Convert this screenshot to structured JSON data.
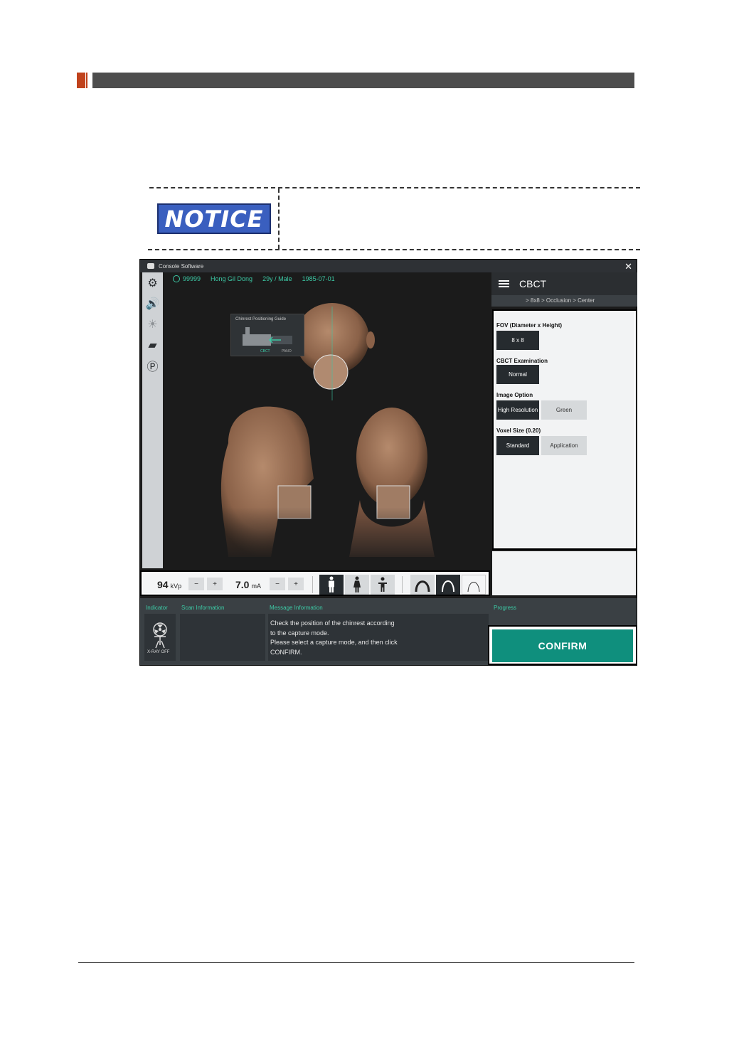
{
  "notice": {
    "label": "NOTICE"
  },
  "window": {
    "title": "Console Software",
    "close": "✕"
  },
  "patient": {
    "id": "99999",
    "name": "Hong Gil Dong",
    "age_sex": "29y / Male",
    "dob": "1985-07-01"
  },
  "toolbar": {
    "items": [
      {
        "icon": "gear-icon",
        "glyph": "⚙"
      },
      {
        "icon": "speaker-icon",
        "glyph": "🔊"
      },
      {
        "icon": "light-icon",
        "glyph": "☀"
      },
      {
        "icon": "layers-icon",
        "glyph": "▰"
      },
      {
        "icon": "p-settings-icon",
        "glyph": "Ⓟ"
      }
    ]
  },
  "guide": {
    "title": "Chinrest Positioning Guide",
    "cbct": "CBCT",
    "pano": "PANO"
  },
  "panel": {
    "mode": "CBCT",
    "breadcrumb": "> 8x8 > Occlusion > Center",
    "fov_label": "FOV (Diameter x Height)",
    "fov_value": "8 x 8",
    "exam_label": "CBCT Examination",
    "exam_value": "Normal",
    "image_label": "Image Option",
    "image_opt1": "High Resolution",
    "image_opt2": "Green",
    "voxel_label": "Voxel Size (0.20)",
    "voxel_opt1": "Standard",
    "voxel_opt2": "Application"
  },
  "controls": {
    "kvp_value": "94",
    "kvp_unit": "kVp",
    "ma_value": "7.0",
    "ma_unit": "mA",
    "minus": "−",
    "plus": "+"
  },
  "info": {
    "indicator": "Indicator",
    "scan": "Scan Information",
    "message_h": "Message Information",
    "progress": "Progress",
    "xray": "X-RAY OFF",
    "msg1": "Check the position of the chinrest according",
    "msg2": "to the capture mode.",
    "msg3": "Please select a capture mode, and then click",
    "msg4": "CONFIRM."
  },
  "confirm": "CONFIRM",
  "colors": {
    "accent": "#0f8f7d",
    "highlight": "#3cc9a5",
    "notice": "#3a5fbf"
  }
}
